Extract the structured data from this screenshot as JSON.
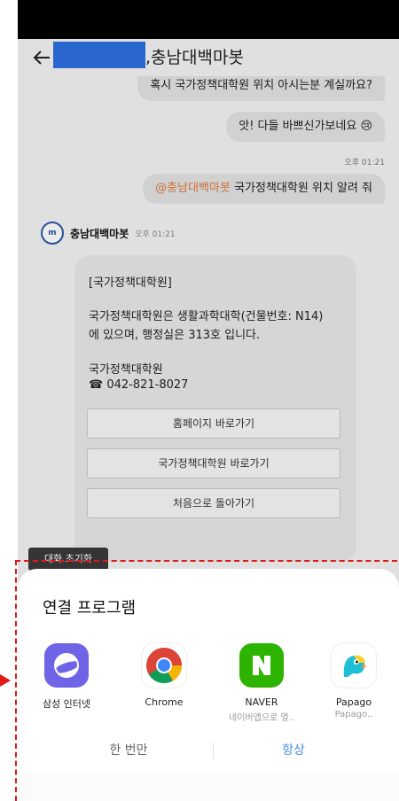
{
  "header": {
    "title": ",충남대백마봇"
  },
  "messages": {
    "user_clipped": "혹시 국가정책대학원 위치 아시는분 계실까요?",
    "user_1": "앗! 다들 바쁘신가보네요 😢",
    "time_user": "오후 01:21",
    "mention": "@충남대백마봇",
    "user_2_rest": " 국가정책대학원 위치 알려 줘"
  },
  "bot": {
    "name": "충남대백마봇",
    "time": "오후 01:21",
    "avatar_text": "m"
  },
  "card": {
    "line1": "[국가정책대학원]",
    "line2": "국가정책대학원은 생활과학대학(건물번호: N14)",
    "line3": "에 있으며, 행정실은 313호 입니다.",
    "line4": "국가정책대학원",
    "line5": "☎ 042-821-8027",
    "buttons": [
      "홈페이지 바로가기",
      "국가정책대학원 바로가기",
      "처음으로 돌아가기"
    ]
  },
  "reset_chip": "대화 초기화",
  "sheet": {
    "title": "연결 프로그램",
    "apps": [
      {
        "label": "삼성 인터넷",
        "sub": "",
        "icon": "samsung-internet-icon",
        "color": "#6f63e6"
      },
      {
        "label": "Chrome",
        "sub": "",
        "icon": "chrome-icon",
        "color": "#ffffff"
      },
      {
        "label": "NAVER",
        "sub": "네이버앱으로 열..",
        "icon": "naver-icon",
        "color": "#2db400"
      },
      {
        "label": "Papago",
        "sub": "Papago..",
        "icon": "papago-icon",
        "color": "#ffffff"
      }
    ],
    "once": "한 번만",
    "always": "항상"
  }
}
